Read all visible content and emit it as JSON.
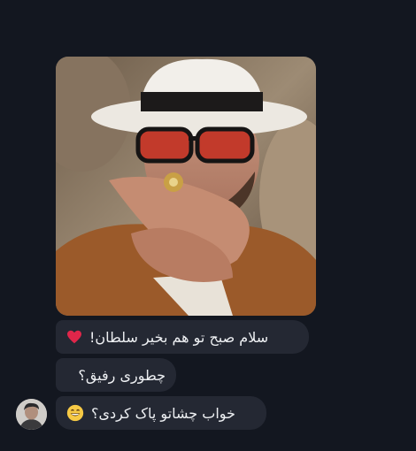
{
  "messages": [
    {
      "text": "سلام صبح تو هم بخیر سلطان!",
      "emoji": "red-heart"
    },
    {
      "text": "چطوری رفیق؟"
    },
    {
      "text": "خواب چشاتو پاک کردی؟",
      "emoji": "grinning-face"
    }
  ],
  "photo": {
    "subject": "man-in-white-hat-with-red-sunglasses-holding-ring"
  },
  "colors": {
    "background": "#131720",
    "bubble": "#242833",
    "text": "#eef0f3",
    "heart": "#e0264a",
    "emoji": "#f6c945"
  }
}
